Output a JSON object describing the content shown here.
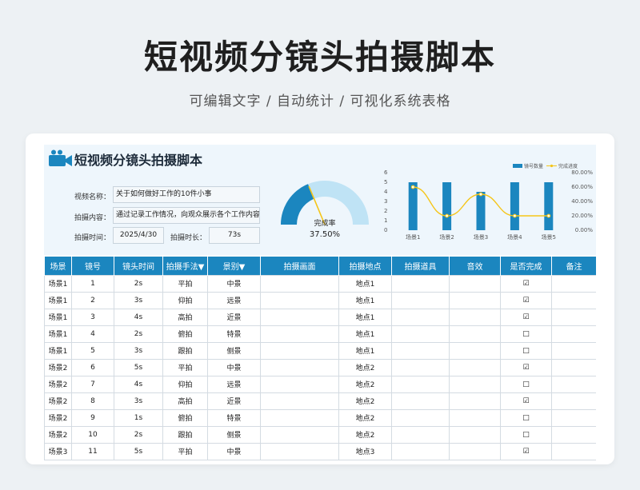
{
  "page": {
    "title": "短视频分镜头拍摄脚本",
    "subtitle": "可编辑文字 / 自动统计 / 可视化系统表格"
  },
  "sheet": {
    "title": "短视频分镜头拍摄脚本",
    "info": {
      "name_label": "视频名称：",
      "name_value": "关于如何做好工作的10件小事",
      "content_label": "拍摄内容：",
      "content_value": "通过记录工作情况，向观众展示各个工作内容",
      "time_label": "拍摄时间：",
      "time_value": "2025/4/30",
      "duration_label": "拍摄时长：",
      "duration_value": "73s"
    }
  },
  "gauge": {
    "label": "完成率",
    "value_text": "37.50%",
    "value": 0.375,
    "color": "#1b86bf",
    "track": "#bfe3f5"
  },
  "chart_data": {
    "type": "bar",
    "categories": [
      "场景1",
      "场景2",
      "场景3",
      "场景4",
      "场景5"
    ],
    "series": [
      {
        "name": "镜号数量",
        "type": "bar",
        "axis": "left",
        "values": [
          5,
          5,
          4,
          5,
          5
        ]
      },
      {
        "name": "完成进度",
        "type": "line",
        "axis": "right",
        "values": [
          0.6,
          0.2,
          0.5,
          0.2,
          0.2
        ]
      }
    ],
    "left_ticks": [
      "6",
      "5",
      "4",
      "3",
      "2",
      "1",
      "0"
    ],
    "right_ticks": [
      "80.00%",
      "60.00%",
      "40.00%",
      "20.00%",
      "0.00%"
    ],
    "ylim_left": [
      0,
      6
    ],
    "ylim_right": [
      0,
      0.8
    ],
    "legend_position": "top-right",
    "colors": {
      "bar": "#1b86bf",
      "line": "#f5c518"
    }
  },
  "table": {
    "headers": [
      "场景",
      "镜号",
      "镜头时间",
      "拍摄手法▼",
      "景别▼",
      "拍摄画面",
      "拍摄地点",
      "拍摄道具",
      "音效",
      "是否完成",
      "备注"
    ],
    "rows": [
      {
        "scene": "场景1",
        "no": "1",
        "time": "2s",
        "method": "平拍",
        "shot": "中景",
        "frame": "",
        "location": "地点1",
        "prop": "",
        "sound": "",
        "done": "☑",
        "note": ""
      },
      {
        "scene": "场景1",
        "no": "2",
        "time": "3s",
        "method": "仰拍",
        "shot": "远景",
        "frame": "",
        "location": "地点1",
        "prop": "",
        "sound": "",
        "done": "☑",
        "note": ""
      },
      {
        "scene": "场景1",
        "no": "3",
        "time": "4s",
        "method": "高拍",
        "shot": "近景",
        "frame": "",
        "location": "地点1",
        "prop": "",
        "sound": "",
        "done": "☑",
        "note": ""
      },
      {
        "scene": "场景1",
        "no": "4",
        "time": "2s",
        "method": "俯拍",
        "shot": "特景",
        "frame": "",
        "location": "地点1",
        "prop": "",
        "sound": "",
        "done": "□",
        "note": ""
      },
      {
        "scene": "场景1",
        "no": "5",
        "time": "3s",
        "method": "跟拍",
        "shot": "侧景",
        "frame": "",
        "location": "地点1",
        "prop": "",
        "sound": "",
        "done": "□",
        "note": ""
      },
      {
        "scene": "场景2",
        "no": "6",
        "time": "5s",
        "method": "平拍",
        "shot": "中景",
        "frame": "",
        "location": "地点2",
        "prop": "",
        "sound": "",
        "done": "☑",
        "note": ""
      },
      {
        "scene": "场景2",
        "no": "7",
        "time": "4s",
        "method": "仰拍",
        "shot": "远景",
        "frame": "",
        "location": "地点2",
        "prop": "",
        "sound": "",
        "done": "□",
        "note": ""
      },
      {
        "scene": "场景2",
        "no": "8",
        "time": "3s",
        "method": "高拍",
        "shot": "近景",
        "frame": "",
        "location": "地点2",
        "prop": "",
        "sound": "",
        "done": "☑",
        "note": ""
      },
      {
        "scene": "场景2",
        "no": "9",
        "time": "1s",
        "method": "俯拍",
        "shot": "特景",
        "frame": "",
        "location": "地点2",
        "prop": "",
        "sound": "",
        "done": "□",
        "note": ""
      },
      {
        "scene": "场景2",
        "no": "10",
        "time": "2s",
        "method": "跟拍",
        "shot": "侧景",
        "frame": "",
        "location": "地点2",
        "prop": "",
        "sound": "",
        "done": "□",
        "note": ""
      },
      {
        "scene": "场景3",
        "no": "11",
        "time": "5s",
        "method": "平拍",
        "shot": "中景",
        "frame": "",
        "location": "地点3",
        "prop": "",
        "sound": "",
        "done": "☑",
        "note": ""
      }
    ]
  },
  "icons": {
    "title_icon": "video-camera-icon"
  }
}
